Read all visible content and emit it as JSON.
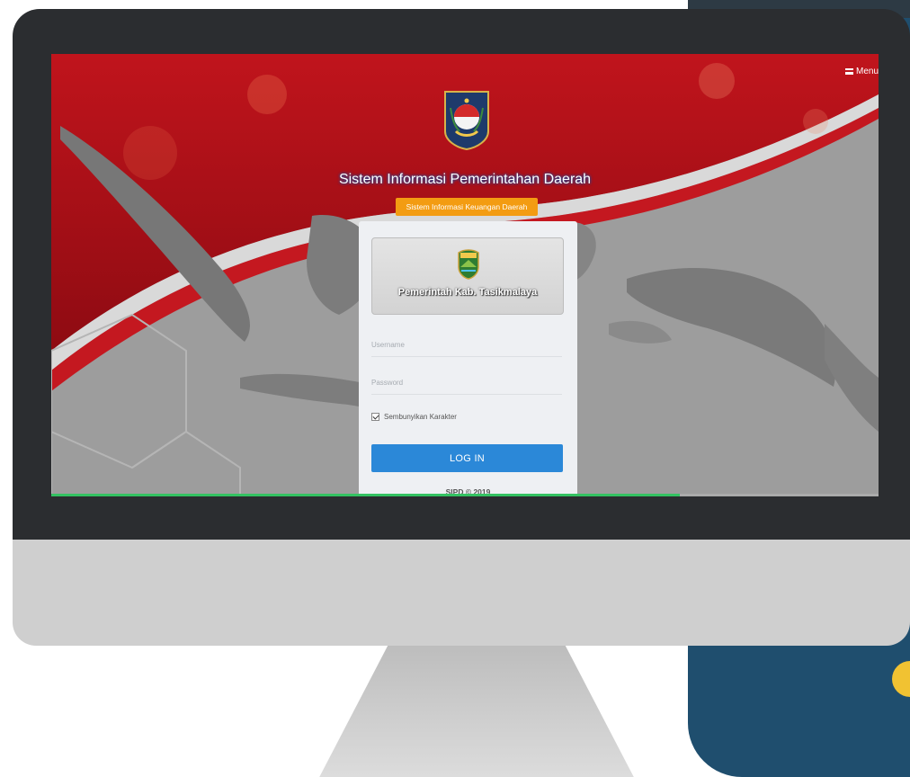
{
  "header": {
    "menu_label": "Menu",
    "menu_icon": "hamburger-icon",
    "system_title": "Sistem Informasi Pemerintahan Daerah",
    "subsystem_badge": "Sistem Informasi Keuangan Daerah"
  },
  "login": {
    "organization_name": "Pemerintah Kab. Tasikmalaya",
    "username_placeholder": "Username",
    "username_value": "",
    "password_placeholder": "Password",
    "password_value": "",
    "hide_characters_label": "Sembunyikan Karakter",
    "hide_characters_checked": true,
    "login_button": "LOG IN",
    "footer": "SIPD © 2019"
  },
  "progress": {
    "fraction": 0.76
  },
  "colors": {
    "banner_red": "#b5121b",
    "badge_orange": "#f39c12",
    "button_blue": "#2b88d8",
    "progress_green": "#33c262"
  }
}
